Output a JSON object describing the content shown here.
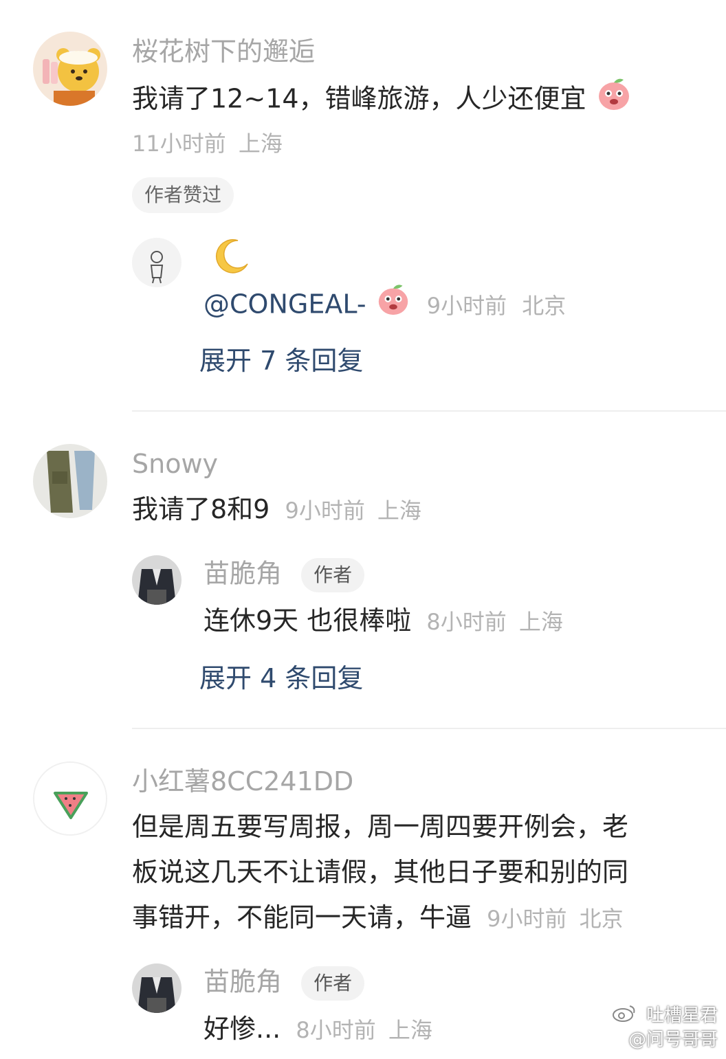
{
  "comments": [
    {
      "username": "桜花树下的邂逅",
      "text": "我请了12~14，错峰旅游，人少还便宜",
      "time": "11小时前",
      "location": "上海",
      "liked_badge": "作者赞过",
      "reply_preview": {
        "line1": "",
        "mention": "@CONGEAL-",
        "time": "9小时前",
        "location": "北京"
      },
      "expand_label": "展开 7 条回复"
    },
    {
      "username": "Snowy",
      "text": "我请了8和9",
      "time": "9小时前",
      "location": "上海",
      "reply": {
        "username": "苗脆角",
        "author_tag": "作者",
        "text": "连休9天 也很棒啦",
        "time": "8小时前",
        "location": "上海"
      },
      "expand_label": "展开 4 条回复"
    },
    {
      "username": "小红薯8CC241DD",
      "text_lines": [
        "但是周五要写周报，周一周四要开例会，老",
        "板说这几天不让请假，其他日子要和别的同",
        "事错开，不能同一天请，牛逼"
      ],
      "time": "9小时前",
      "location": "北京",
      "reply": {
        "username": "苗脆角",
        "author_tag": "作者",
        "text": "好惨...",
        "time": "8小时前",
        "location": "上海"
      }
    }
  ],
  "watermark": {
    "line1": "吐槽星君",
    "line2": "@问号哥哥"
  },
  "icons": [
    "peach-emoji-icon",
    "moon-emoji-icon",
    "watermelon-icon",
    "weibo-logo-icon"
  ]
}
